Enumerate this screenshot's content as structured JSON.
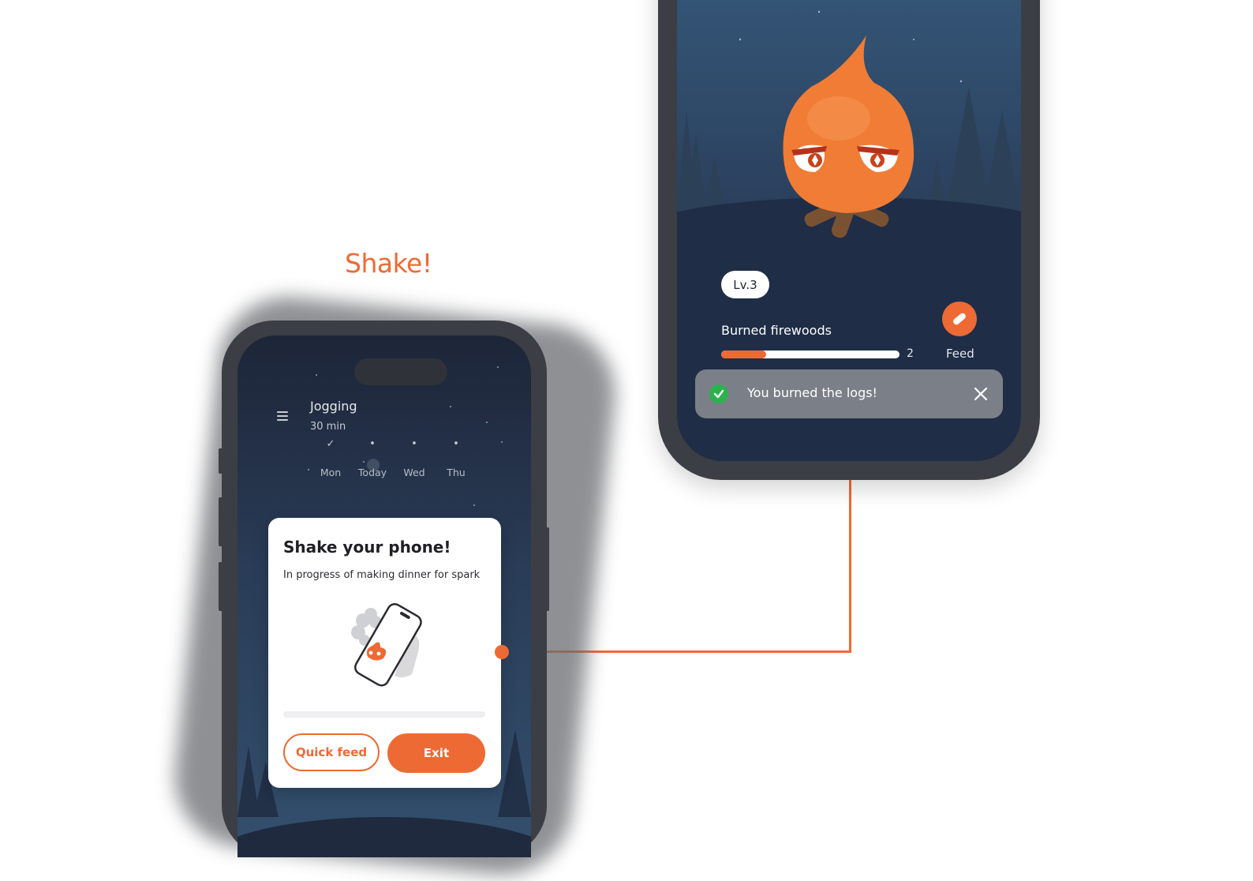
{
  "colors": {
    "accent": "#ee6a34",
    "success": "#2bb24c",
    "card": "#ffffff"
  },
  "caption": "Shake!",
  "left_phone": {
    "header": {
      "menu_icon": "hamburger-menu-icon",
      "title": "Jogging",
      "subtitle": "30 min"
    },
    "days": [
      {
        "label": "Mon",
        "mark": "✓",
        "state": "done"
      },
      {
        "label": "Today",
        "mark": "•",
        "state": "current"
      },
      {
        "label": "Wed",
        "mark": "•",
        "state": "upcoming"
      },
      {
        "label": "Thu",
        "mark": "•",
        "state": "upcoming"
      }
    ],
    "modal": {
      "title": "Shake your phone!",
      "description": "In progress of making dinner for spark",
      "illustration": "hand-shaking-phone-with-spark",
      "progress": 0,
      "quick_feed_label": "Quick feed",
      "exit_label": "Exit"
    }
  },
  "right_phone": {
    "character": "flame-mascot-on-logs",
    "level_label": "Lv.3",
    "burned_label": "Burned firewoods",
    "burned_progress": 0.25,
    "burned_count": "2",
    "feed_icon": "log-icon",
    "feed_label": "Feed",
    "toast": {
      "icon": "check-circle-icon",
      "message": "You burned the logs!",
      "close_icon": "close-icon"
    }
  }
}
